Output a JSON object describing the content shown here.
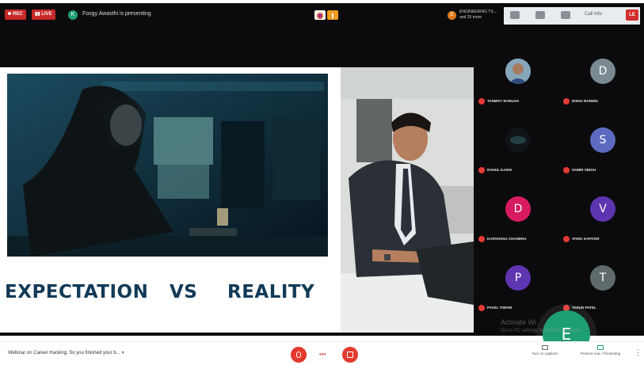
{
  "topbar": {
    "rec_label": "REC",
    "live_label": "LIVE",
    "presenter_initial": "K",
    "presenter_text": "Foxgy Awasthi is presenting",
    "host_initial": "E",
    "host_text": "ENGINEERING TIL... and 25 more",
    "toolbar_label": "Call Info",
    "leave_label": "LE"
  },
  "slide": {
    "title_left": "EXPECTATION",
    "title_mid": "VS",
    "title_right": "REALITY"
  },
  "participants": [
    {
      "initial": "",
      "name": "TANMOY BARUAH",
      "color": "#7a8f9c"
    },
    {
      "initial": "D",
      "name": "DISHA BARDIN",
      "color": "#7b8a92"
    },
    {
      "initial": "",
      "name": "RAHUL KASHI",
      "color": "#0b0b0d"
    },
    {
      "initial": "S",
      "name": "SAMIR SINGH",
      "color": "#5c6bc0"
    },
    {
      "initial": "D",
      "name": "DARSHANA CHANDRA",
      "color": "#d81b60"
    },
    {
      "initial": "V",
      "name": "VIVEK KAPOOR",
      "color": "#5e35b1"
    },
    {
      "initial": "P",
      "name": "PAVEL TIWARI",
      "color": "#5e35b1"
    },
    {
      "initial": "T",
      "name": "TARUN PATEL",
      "color": "#5f6a6a"
    }
  ],
  "fab_initial": "E",
  "watermark": {
    "line1": "Activate Wi",
    "line2": "Go to PC settings to activate Windows"
  },
  "bottombar": {
    "meeting_title": "Webinar on Career Hacking: So you finished your b...",
    "caret": "▾",
    "mid_glyph": "•••",
    "action1": "Turn on captions",
    "action2": "Present now / Presenting",
    "more": "⋮"
  }
}
